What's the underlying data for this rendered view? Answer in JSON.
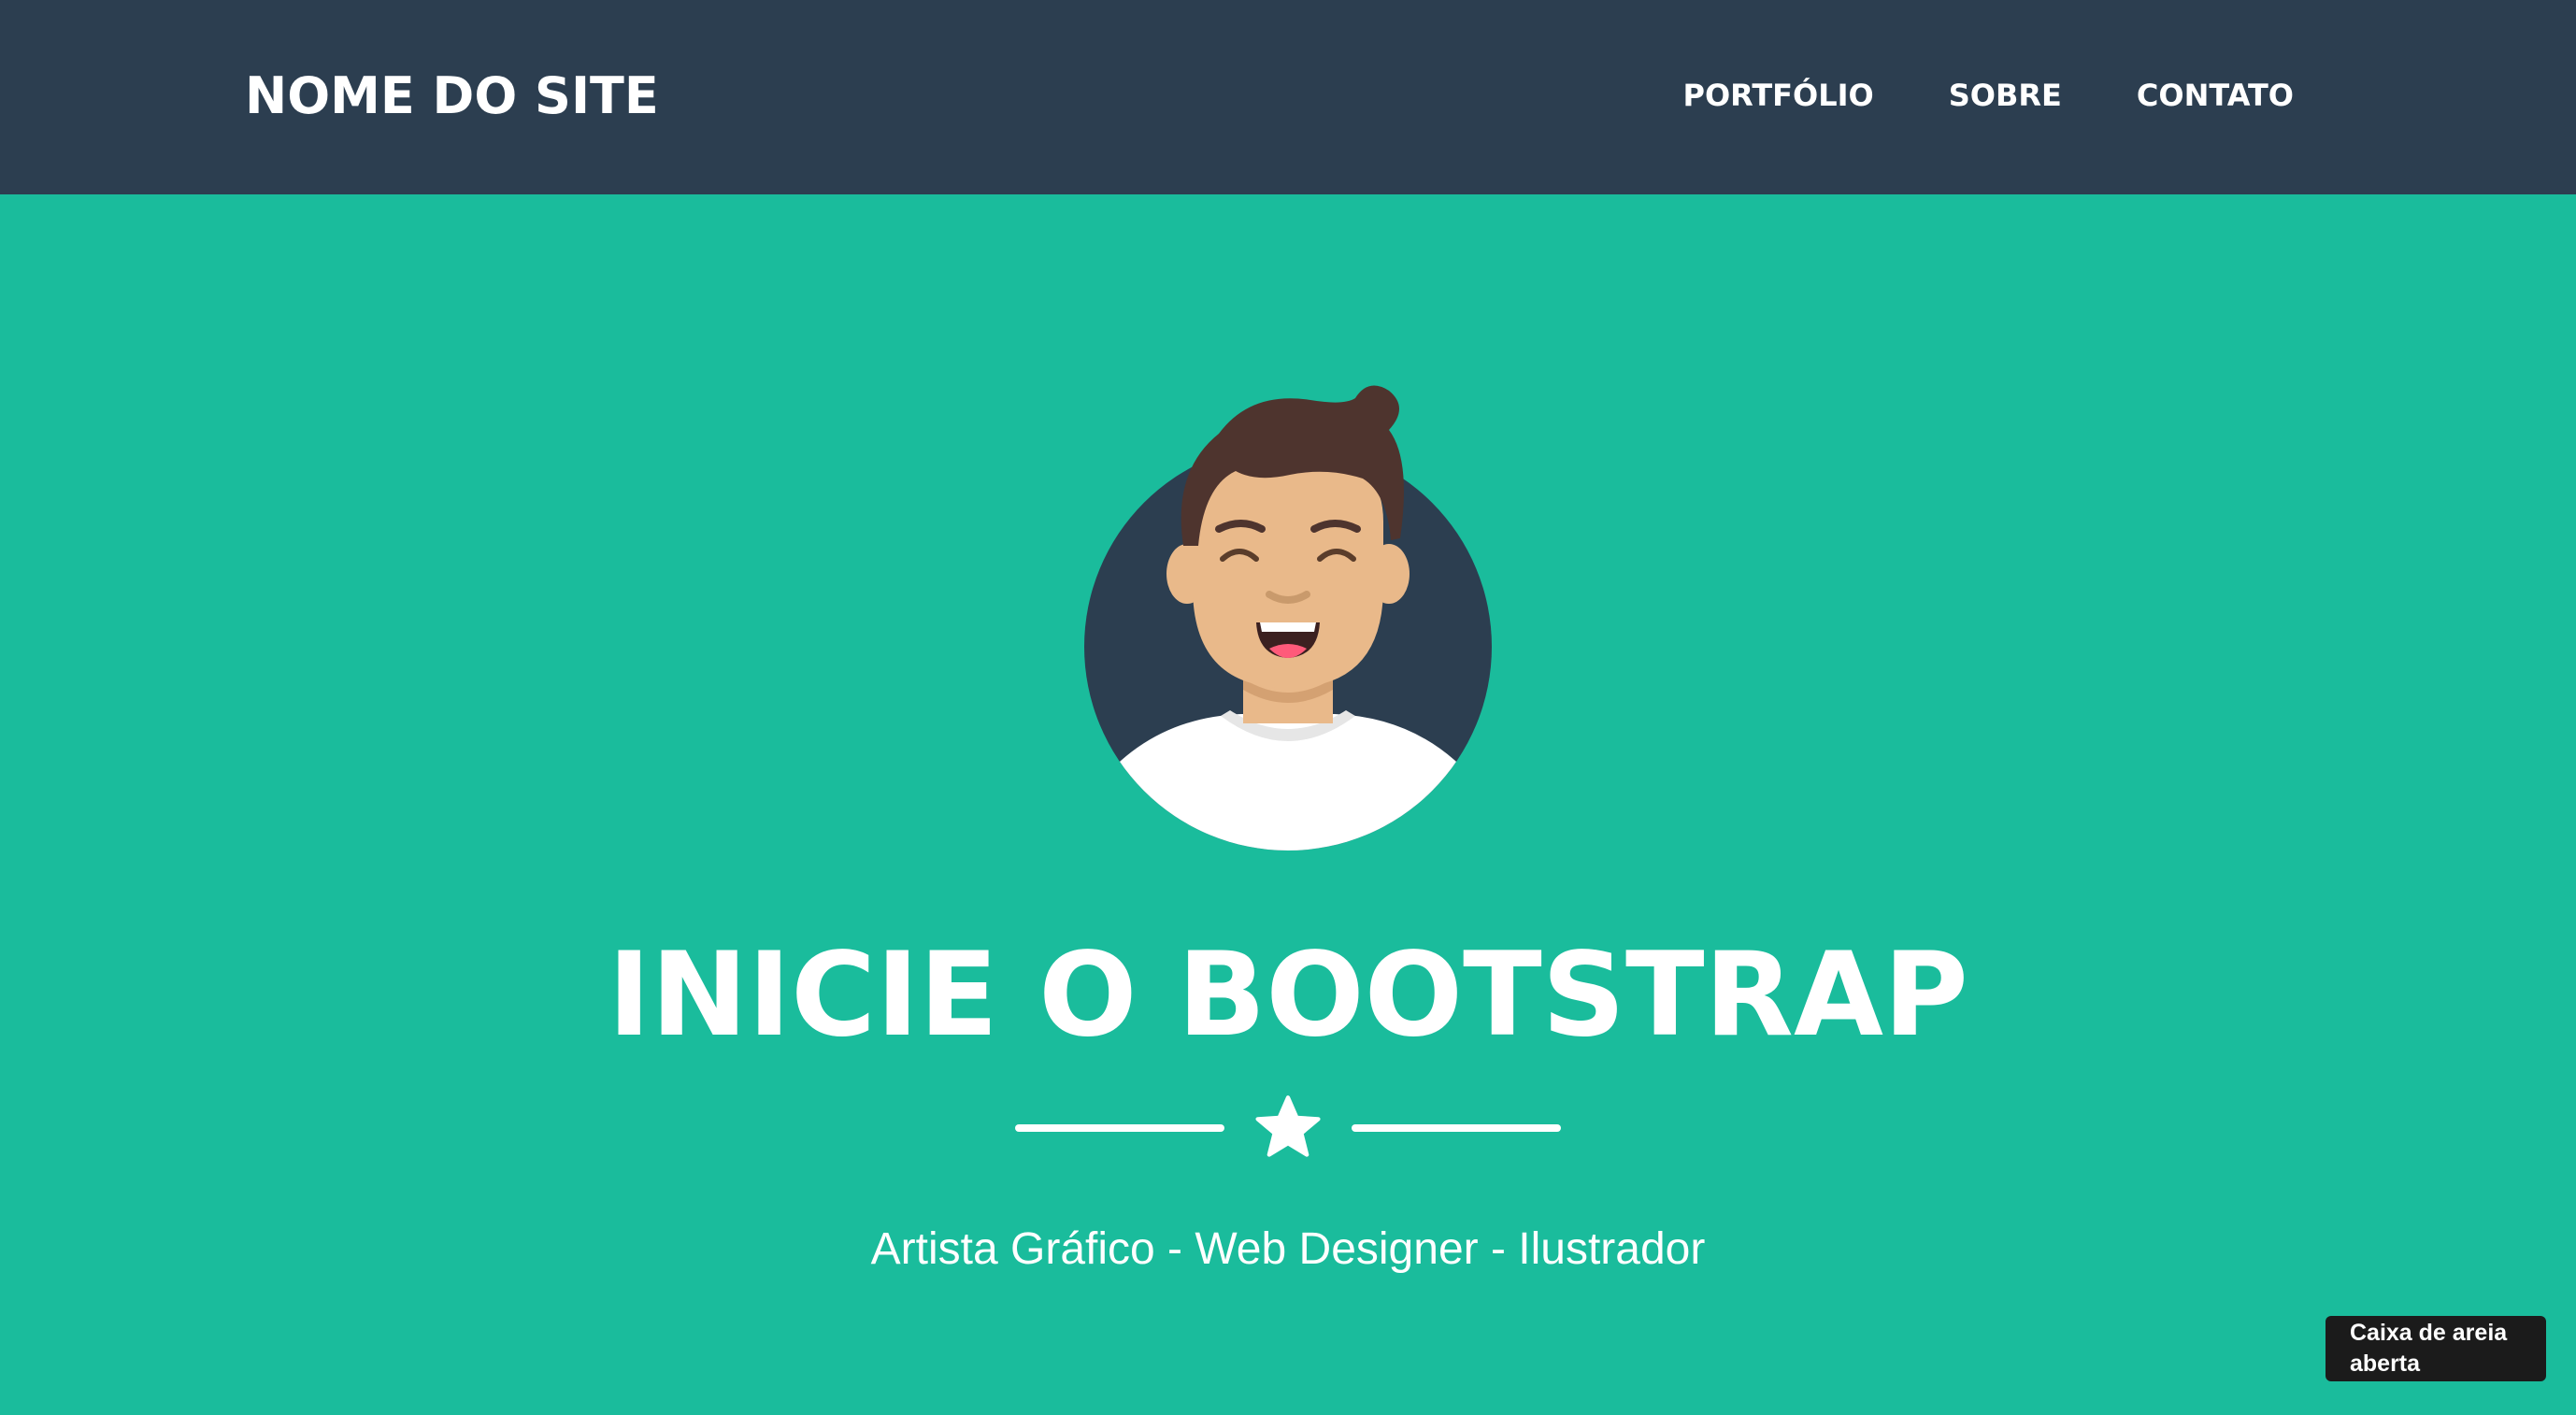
{
  "navbar": {
    "brand": "NOME DO SITE",
    "links": [
      "PORTFÓLIO",
      "SOBRE",
      "CONTATO"
    ]
  },
  "masthead": {
    "avatar_icon": "avataaar-smiling-man-icon",
    "heading": "INICIE O BOOTSTRAP",
    "divider_icon": "star-icon",
    "subheading": "Artista Gráfico - Web Designer - Ilustrador"
  },
  "sandbox_badge": {
    "text": "Caixa de areia aberta"
  },
  "colors": {
    "navbar_bg": "#2c3e50",
    "masthead_bg": "#1abc9c",
    "text": "#ffffff",
    "avatar_circle": "#2c3e50",
    "skin": "#e9b98a",
    "hair": "#4e342e",
    "badge_bg": "#1b1b1b"
  }
}
